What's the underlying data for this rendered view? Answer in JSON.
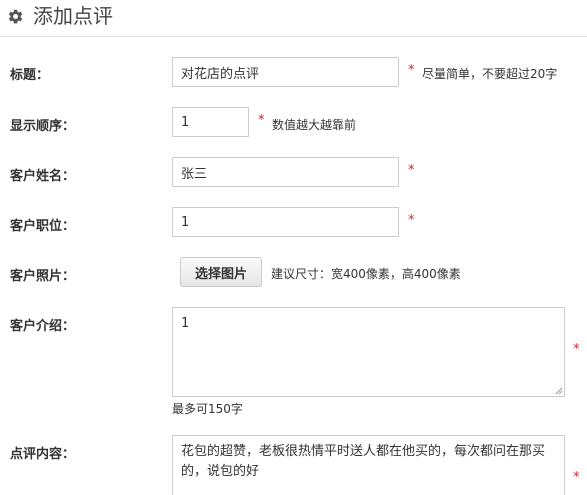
{
  "header": {
    "icon": "gear-icon",
    "title": "添加点评"
  },
  "form": {
    "title": {
      "label": "标题：",
      "value": "对花店的点评",
      "required_mark": "*",
      "hint": "尽量简单，不要超过20字"
    },
    "display_order": {
      "label": "显示顺序：",
      "value": "1",
      "required_mark": "*",
      "hint": "数值越大越靠前"
    },
    "customer_name": {
      "label": "客户姓名：",
      "value": "张三",
      "required_mark": "*"
    },
    "customer_position": {
      "label": "客户职位：",
      "value": "1",
      "required_mark": "*"
    },
    "customer_photo": {
      "label": "客户照片：",
      "button_label": "选择图片",
      "hint": "建议尺寸：宽400像素，高400像素"
    },
    "customer_intro": {
      "label": "客户介绍：",
      "value": "1",
      "required_mark": "*",
      "hint": "最多可150字"
    },
    "review_content": {
      "label": "点评内容：",
      "value": "花包的超赞，老板很热情平时送人都在他买的，每次都问在那买的，说包的好",
      "required_mark": "*"
    }
  },
  "colors": {
    "required": "#e02020",
    "border": "#cccccc"
  }
}
